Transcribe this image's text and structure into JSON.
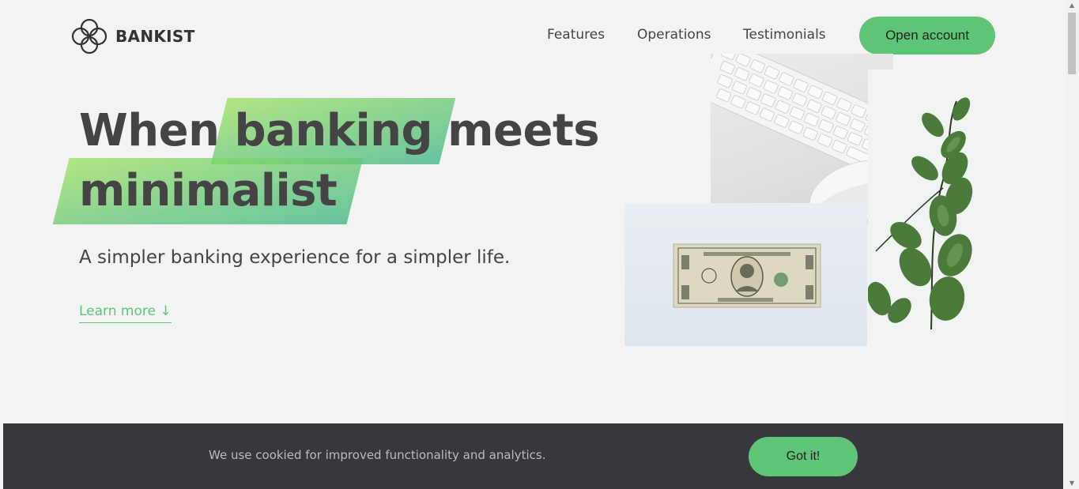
{
  "nav": {
    "logo_text": "BANKIST",
    "links": [
      "Features",
      "Operations",
      "Testimonials"
    ],
    "cta": "Open account"
  },
  "hero": {
    "title_part1": "When",
    "title_highlight1": "banking",
    "title_part2": "meets",
    "title_highlight2": "minimalist",
    "subtitle": "A simpler banking experience for a simpler life.",
    "learn_more": "Learn more ↓"
  },
  "cookie": {
    "message": "We use cookied for improved functionality and analytics.",
    "button": "Got it!"
  },
  "colors": {
    "accent": "#5ec576",
    "gradient_start": "#9be15d",
    "gradient_end": "#39b385",
    "banner_bg": "#37383d",
    "page_bg": "#f3f3f3"
  },
  "icons": [
    "logo-icon",
    "scroll-up-arrow-icon",
    "scroll-down-arrow-icon"
  ]
}
